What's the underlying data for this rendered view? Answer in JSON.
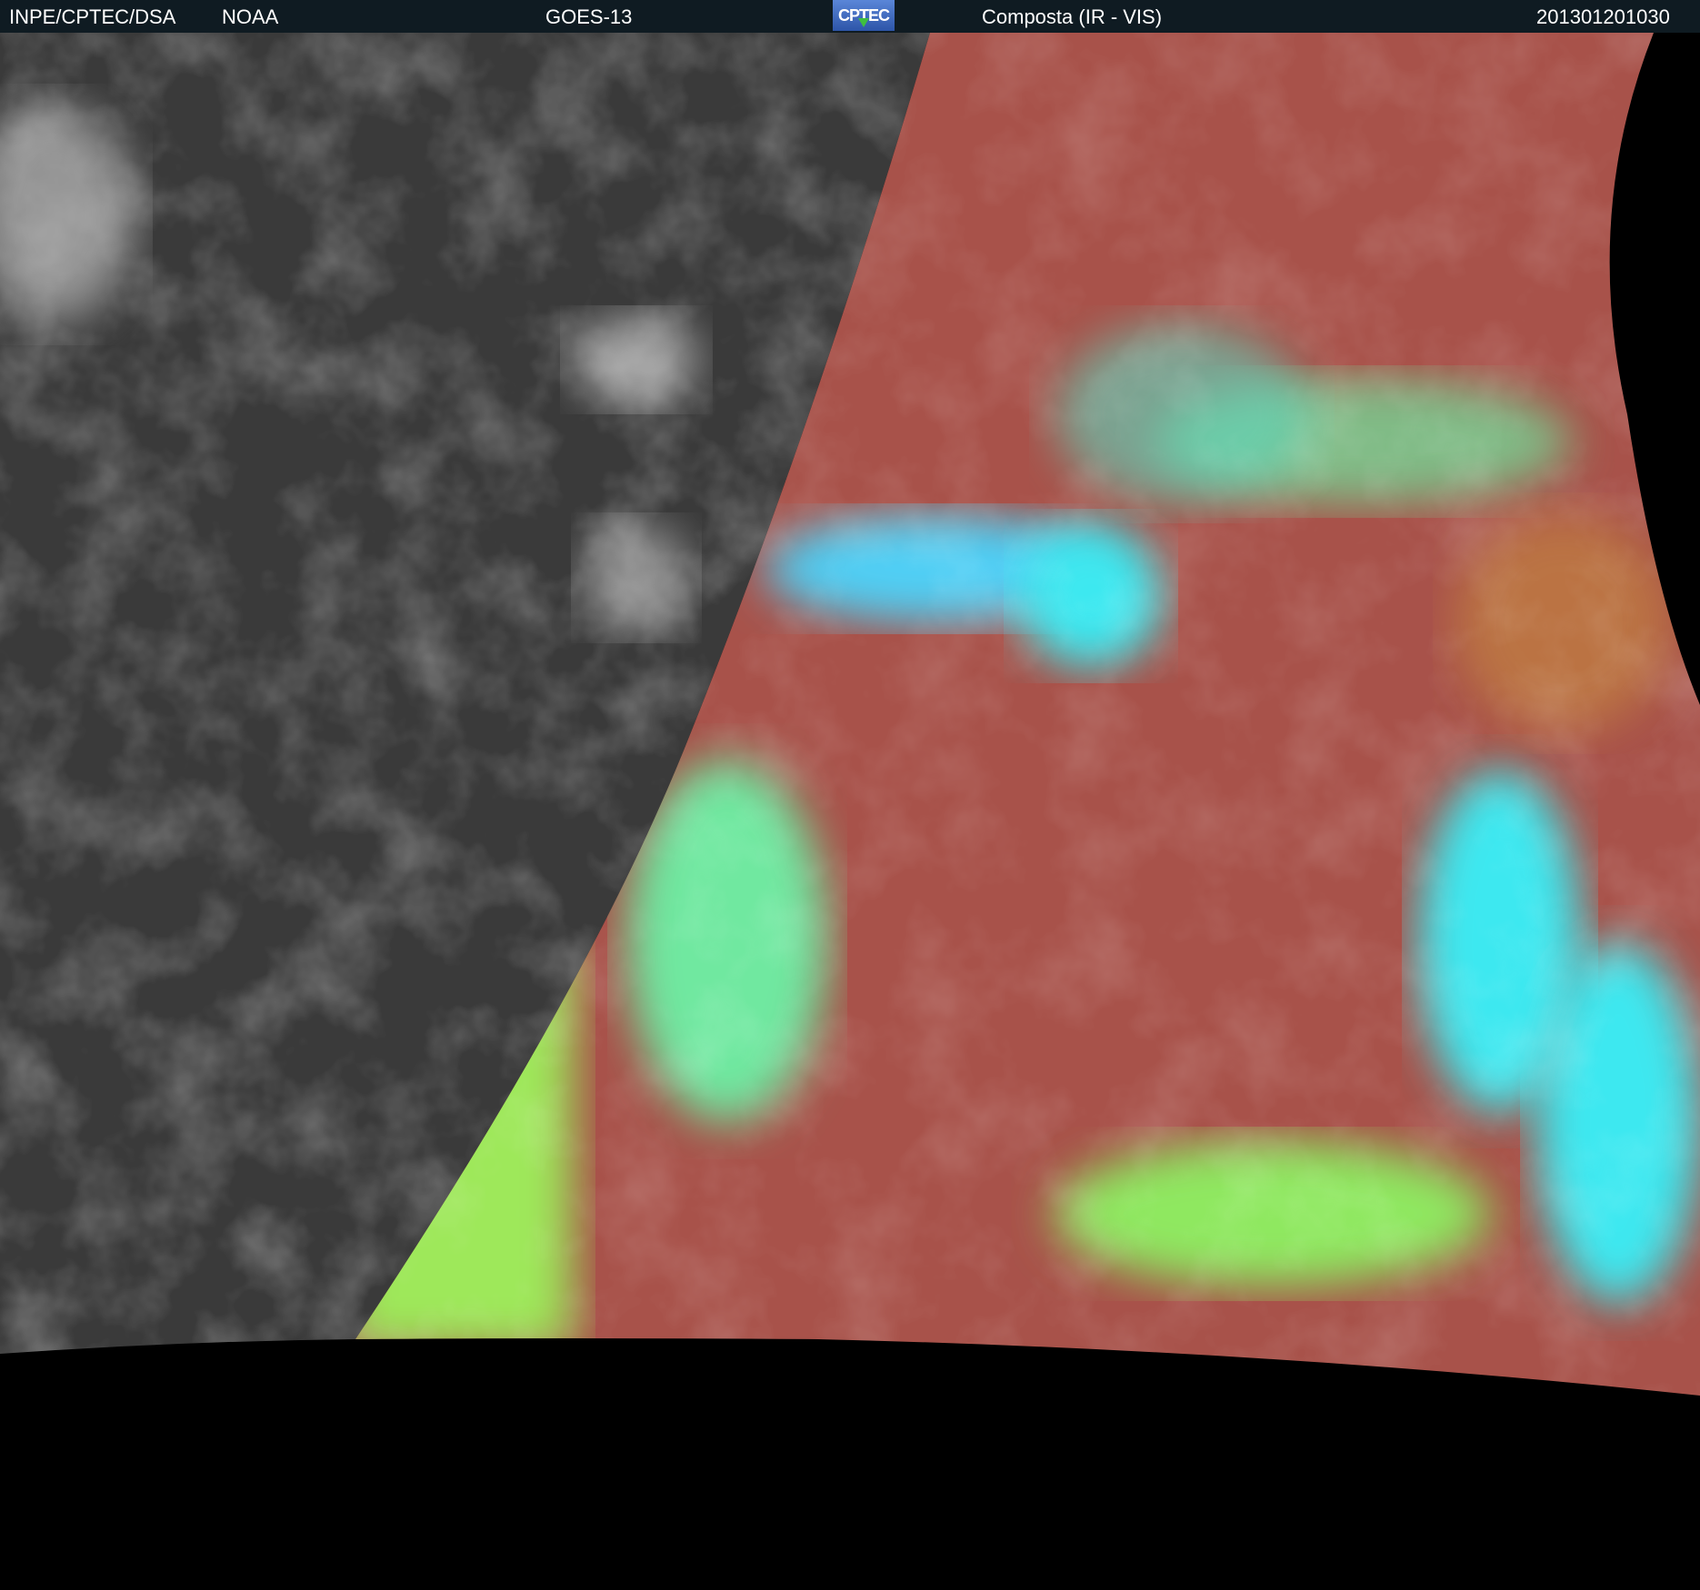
{
  "header": {
    "source": "INPE/CPTEC/DSA",
    "agency": "NOAA",
    "satellite": "GOES-13",
    "logo_text": "CPTEC",
    "product": "Composta (IR - VIS)",
    "timestamp": "201301201030"
  },
  "colors": {
    "header_bg": "#0f1b22",
    "ir_gray": "#3a3a3a",
    "composite_red": "#a8524a",
    "composite_green": "#8fe860",
    "composite_cyan": "#3de8f0"
  }
}
